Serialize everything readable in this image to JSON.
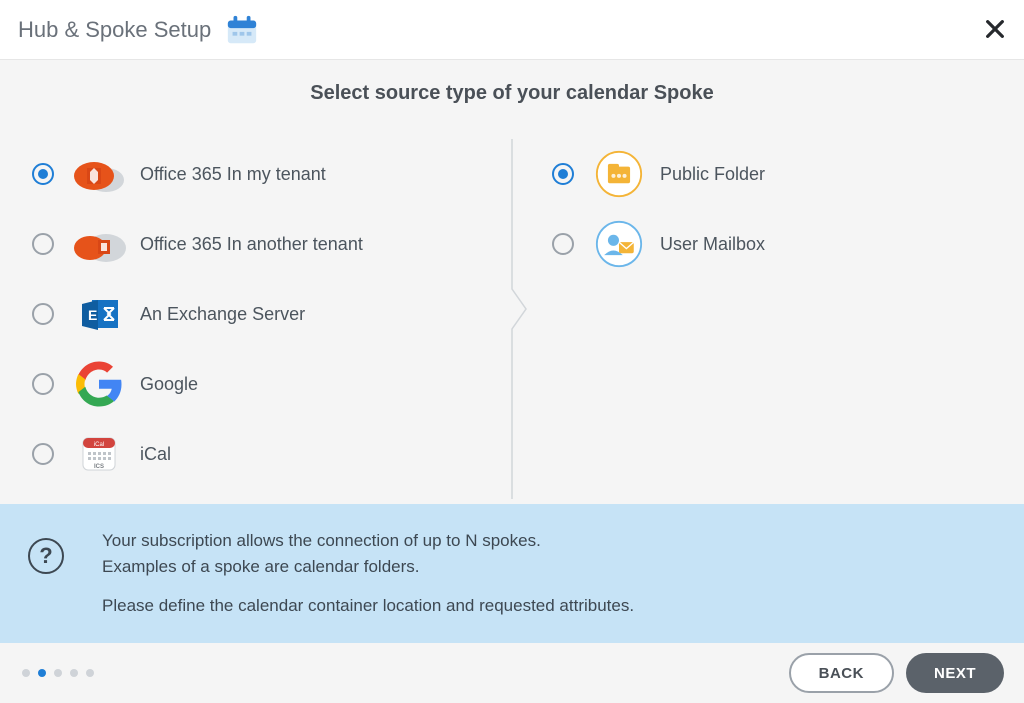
{
  "header": {
    "title": "Hub & Spoke Setup"
  },
  "subtitle": "Select source type of your calendar Spoke",
  "left_options": [
    {
      "id": "o365-my",
      "label": "Office 365 In my tenant",
      "icon": "office365-my-tenant-icon",
      "selected": true
    },
    {
      "id": "o365-other",
      "label": "Office 365 In another tenant",
      "icon": "office365-other-tenant-icon",
      "selected": false
    },
    {
      "id": "exchange",
      "label": "An Exchange Server",
      "icon": "exchange-server-icon",
      "selected": false
    },
    {
      "id": "google",
      "label": "Google",
      "icon": "google-icon",
      "selected": false
    },
    {
      "id": "ical",
      "label": "iCal",
      "icon": "ical-icon",
      "selected": false
    }
  ],
  "right_options": [
    {
      "id": "public-folder",
      "label": "Public Folder",
      "icon": "public-folder-icon",
      "selected": true
    },
    {
      "id": "user-mailbox",
      "label": "User Mailbox",
      "icon": "user-mailbox-icon",
      "selected": false
    }
  ],
  "info": {
    "line1": "Your subscription allows the connection of up to N spokes.",
    "line2": "Examples of a spoke are calendar folders.",
    "line3": "Please define the calendar container location and requested attributes."
  },
  "progress": {
    "total": 5,
    "current": 1
  },
  "buttons": {
    "back": "BACK",
    "next": "NEXT"
  }
}
